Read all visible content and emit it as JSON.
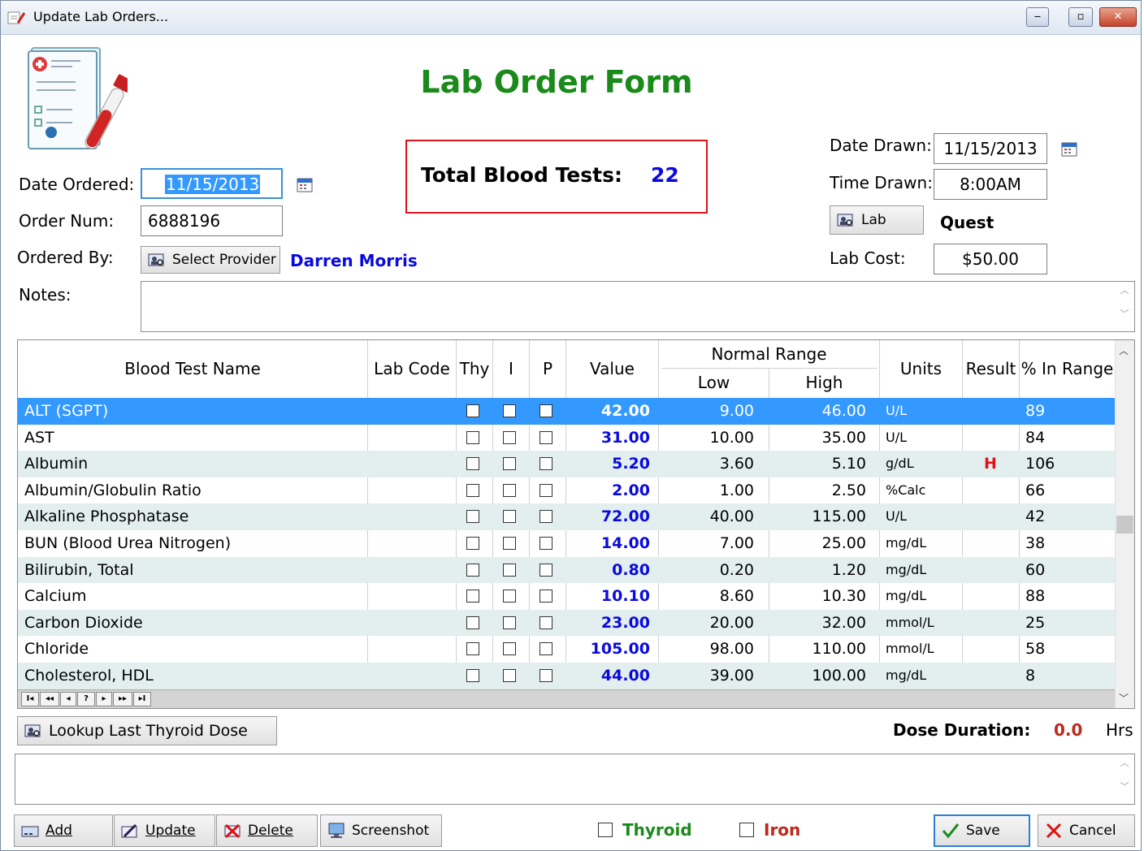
{
  "window": {
    "title": "Update Lab Orders...",
    "controls": {
      "minimize": "‒",
      "maximize": "▫",
      "close": "✕"
    }
  },
  "form": {
    "title": "Lab Order Form",
    "total_label": "Total Blood Tests:",
    "total_value": "22",
    "date_ordered_label": "Date Ordered:",
    "date_ordered_value": "11/15/2013",
    "order_num_label": "Order Num:",
    "order_num_value": "6888196",
    "ordered_by_label": "Ordered By:",
    "select_provider_label": "Select Provider",
    "provider_name": "Darren Morris",
    "notes_label": "Notes:",
    "notes_value": "",
    "date_drawn_label": "Date Drawn:",
    "date_drawn_value": "11/15/2013",
    "time_drawn_label": "Time Drawn:",
    "time_drawn_value": "8:00AM",
    "lab_button_label": "Lab",
    "lab_name": "Quest",
    "lab_cost_label": "Lab Cost:",
    "lab_cost_value": "$50.00"
  },
  "grid": {
    "headers": {
      "name": "Blood Test Name",
      "lab_code": "Lab Code",
      "thy": "Thy",
      "i": "I",
      "p": "P",
      "value": "Value",
      "normal_range": "Normal Range",
      "low": "Low",
      "high": "High",
      "units": "Units",
      "result": "Result",
      "pct": "% In Range"
    },
    "rows": [
      {
        "name": "ALT (SGPT)",
        "lab_code": "",
        "value": "42.00",
        "low": "9.00",
        "high": "46.00",
        "units": "U/L",
        "result": "",
        "pct": "89"
      },
      {
        "name": "AST",
        "lab_code": "",
        "value": "31.00",
        "low": "10.00",
        "high": "35.00",
        "units": "U/L",
        "result": "",
        "pct": "84"
      },
      {
        "name": "Albumin",
        "lab_code": "",
        "value": "5.20",
        "low": "3.60",
        "high": "5.10",
        "units": "g/dL",
        "result": "H",
        "pct": "106"
      },
      {
        "name": "Albumin/Globulin Ratio",
        "lab_code": "",
        "value": "2.00",
        "low": "1.00",
        "high": "2.50",
        "units": "%Calc",
        "result": "",
        "pct": "66"
      },
      {
        "name": "Alkaline Phosphatase",
        "lab_code": "",
        "value": "72.00",
        "low": "40.00",
        "high": "115.00",
        "units": "U/L",
        "result": "",
        "pct": "42"
      },
      {
        "name": "BUN (Blood Urea Nitrogen)",
        "lab_code": "",
        "value": "14.00",
        "low": "7.00",
        "high": "25.00",
        "units": "mg/dL",
        "result": "",
        "pct": "38"
      },
      {
        "name": "Bilirubin, Total",
        "lab_code": "",
        "value": "0.80",
        "low": "0.20",
        "high": "1.20",
        "units": "mg/dL",
        "result": "",
        "pct": "60"
      },
      {
        "name": "Calcium",
        "lab_code": "",
        "value": "10.10",
        "low": "8.60",
        "high": "10.30",
        "units": "mg/dL",
        "result": "",
        "pct": "88"
      },
      {
        "name": "Carbon Dioxide",
        "lab_code": "",
        "value": "23.00",
        "low": "20.00",
        "high": "32.00",
        "units": "mmol/L",
        "result": "",
        "pct": "25"
      },
      {
        "name": "Chloride",
        "lab_code": "",
        "value": "105.00",
        "low": "98.00",
        "high": "110.00",
        "units": "mmol/L",
        "result": "",
        "pct": "58"
      },
      {
        "name": "Cholesterol, HDL",
        "lab_code": "",
        "value": "44.00",
        "low": "39.00",
        "high": "100.00",
        "units": "mg/dL",
        "result": "",
        "pct": "8"
      }
    ],
    "selected_row": 0,
    "navigator": [
      "I◂",
      "◂◂",
      "◂",
      "?",
      "▸",
      "▸▸",
      "▸I"
    ]
  },
  "thyroid": {
    "lookup_label": "Lookup Last Thyroid Dose",
    "dose_duration_label": "Dose Duration:",
    "dose_duration_value": "0.0",
    "dose_duration_units": "Hrs",
    "memo_value": ""
  },
  "footer": {
    "add_label": "Add",
    "update_label": "Update",
    "delete_label": "Delete",
    "screenshot_label": "Screenshot",
    "thyroid_label": "Thyroid",
    "iron_label": "Iron",
    "save_label": "Save",
    "cancel_label": "Cancel"
  },
  "colors": {
    "title_green": "#1a8a1a",
    "provider_blue": "#0a0ae0",
    "alert_red": "#e0121a",
    "selection_blue": "#3399ff",
    "alt_row": "#e3efef",
    "iron_red": "#c0281c"
  },
  "icons": {
    "app": "lab-form-icon",
    "calendar": "calendar-icon",
    "lookup": "person-search-icon",
    "add": "add-icon",
    "update": "pencil-icon",
    "delete": "delete-x-icon",
    "screenshot": "monitor-icon",
    "save": "checkmark-icon",
    "cancel": "x-icon"
  }
}
